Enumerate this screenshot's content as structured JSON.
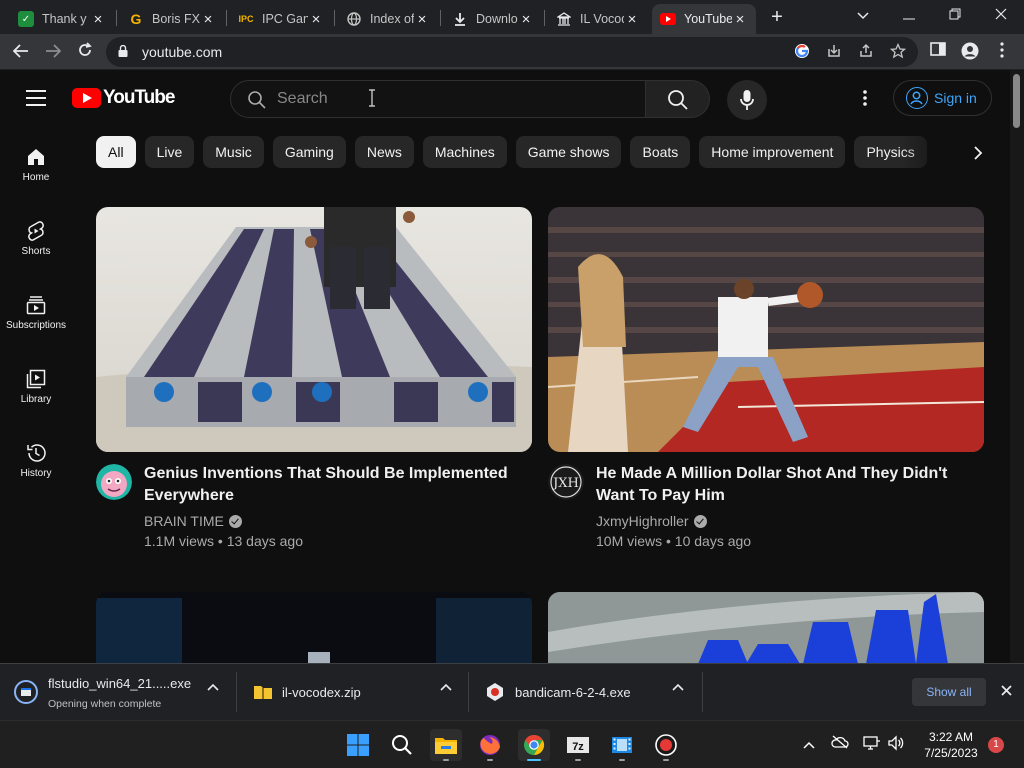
{
  "browser": {
    "tabs": [
      {
        "title": "Thank y",
        "favicon": "green-check-icon",
        "active": false
      },
      {
        "title": "Boris FX",
        "favicon": "g-letter-icon",
        "active": false
      },
      {
        "title": "IPC Gan",
        "favicon": "ipc-games-icon",
        "active": false
      },
      {
        "title": "Index of",
        "favicon": "globe-icon",
        "active": false
      },
      {
        "title": "Downlo",
        "favicon": "download-icon",
        "active": false
      },
      {
        "title": "IL Vocod",
        "favicon": "bank-icon",
        "active": false
      },
      {
        "title": "YouTube",
        "favicon": "youtube-icon",
        "active": true
      }
    ],
    "url": "youtube.com"
  },
  "youtube": {
    "logo_text": "YouTube",
    "search_placeholder": "Search",
    "signin_label": "Sign in",
    "chips": [
      "All",
      "Live",
      "Music",
      "Gaming",
      "News",
      "Machines",
      "Game shows",
      "Boats",
      "Home improvement",
      "Physics"
    ],
    "sidebar": [
      {
        "label": "Home",
        "icon": "home-icon"
      },
      {
        "label": "Shorts",
        "icon": "shorts-icon"
      },
      {
        "label": "Subscriptions",
        "icon": "subscriptions-icon"
      },
      {
        "label": "Library",
        "icon": "library-icon"
      },
      {
        "label": "History",
        "icon": "history-icon"
      }
    ],
    "videos": [
      {
        "title": "Genius Inventions That Should Be Implemented Everywhere",
        "channel": "BRAIN TIME",
        "verified": true,
        "views": "1.1M views",
        "age": "13 days ago",
        "meta": "1.1M views • 13 days ago"
      },
      {
        "title": "He Made A Million Dollar Shot And They Didn't Want To Pay Him",
        "channel": "JxmyHighroller",
        "verified": true,
        "views": "10M views",
        "age": "10 days ago",
        "meta": "10M views • 10 days ago"
      }
    ]
  },
  "downloads": {
    "items": [
      {
        "name": "flstudio_win64_21.....exe",
        "status": "Opening when complete",
        "icon": "installer-icon"
      },
      {
        "name": "il-vocodex.zip",
        "status": "",
        "icon": "zip-folder-icon"
      },
      {
        "name": "bandicam-6-2-4.exe",
        "status": "",
        "icon": "bandicam-icon"
      }
    ],
    "show_all_label": "Show all"
  },
  "taskbar": {
    "apps": [
      "windows-start-icon",
      "search-icon",
      "file-explorer-icon",
      "firefox-icon",
      "chrome-icon",
      "7zip-icon",
      "film-app-icon",
      "record-icon"
    ],
    "time": "3:22 AM",
    "date": "7/25/2023",
    "notification_count": "1"
  },
  "colors": {
    "yt_red": "#ff0000",
    "background": "#0f0f0f",
    "link_blue": "#3ea6ff",
    "chip_bg": "#272727"
  }
}
